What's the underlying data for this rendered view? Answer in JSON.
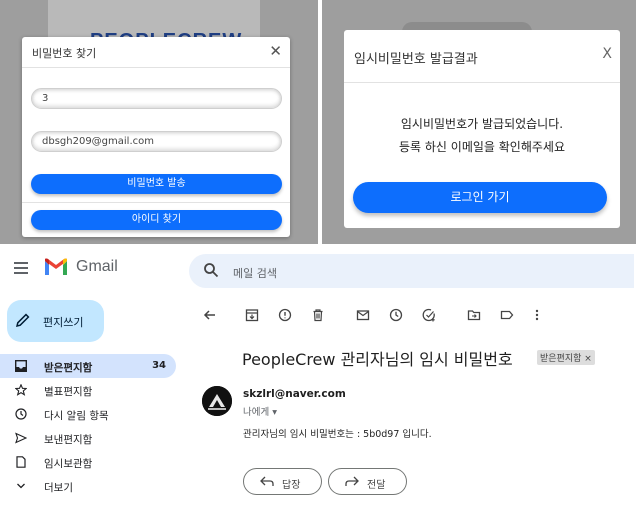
{
  "find_dialog": {
    "title": "비밀번호 찾기",
    "close": "✕",
    "id_value": "3",
    "email_value": "dbsgh209@gmail.com",
    "send_button": "비밀번호 발송",
    "find_id_button": "아이디 찾기",
    "background_logo_text": "PEOPLECREW"
  },
  "result_dialog": {
    "title": "임시비밀번호 발급결과",
    "close": "X",
    "message_line1": "임시비밀번호가 발급되었습니다.",
    "message_line2": "등록 하신 이메일을 확인해주세요",
    "login_button": "로그인 가기"
  },
  "gmail": {
    "brand": "Gmail",
    "search_placeholder": "메일 검색",
    "compose": "편지쓰기",
    "nav": [
      {
        "label": "받은편지함",
        "count": "34",
        "icon": "inbox-icon"
      },
      {
        "label": "별표편지함",
        "icon": "star-icon"
      },
      {
        "label": "다시 알림 항목",
        "icon": "clock-icon"
      },
      {
        "label": "보낸편지함",
        "icon": "send-icon"
      },
      {
        "label": "임시보관함",
        "icon": "draft-icon"
      },
      {
        "label": "더보기",
        "icon": "chevron-down-icon"
      }
    ],
    "email": {
      "subject": "PeopleCrew 관리자님의 임시 비밀번호",
      "label": "받은편지함 ×",
      "sender": "skzlrl@naver.com",
      "recipient": "나에게 ▾",
      "body": "관리자님의 임시 비밀번호는 : 5b0d97 입니다.",
      "reply": "답장",
      "forward": "전달"
    },
    "colors": {
      "accent": "#0d6efd",
      "compose_bg": "#c2e7ff",
      "active_nav_bg": "#d3e3fd"
    }
  }
}
